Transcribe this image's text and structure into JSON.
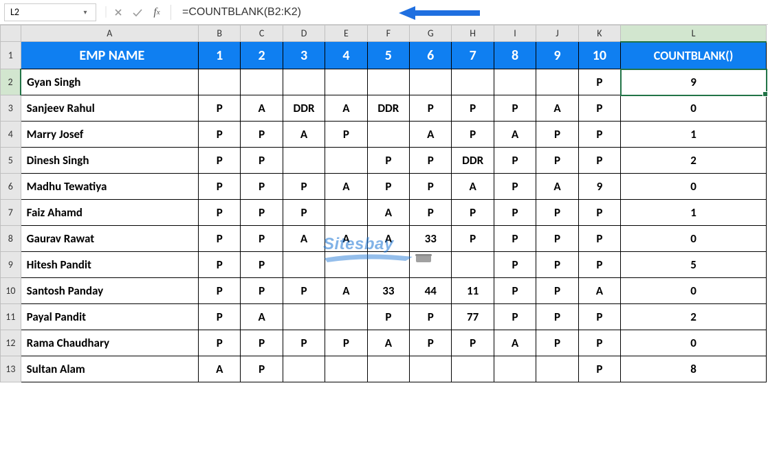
{
  "formula_bar": {
    "name_box": "L2",
    "formula": "=COUNTBLANK(B2:K2)"
  },
  "columns": [
    "A",
    "B",
    "C",
    "D",
    "E",
    "F",
    "G",
    "H",
    "I",
    "J",
    "K",
    "L"
  ],
  "row_numbers": [
    1,
    2,
    3,
    4,
    5,
    6,
    7,
    8,
    9,
    10,
    11,
    12,
    13
  ],
  "selected_cell": "L2",
  "header_row": {
    "name": "EMP NAME",
    "days": [
      "1",
      "2",
      "3",
      "4",
      "5",
      "6",
      "7",
      "8",
      "9",
      "10"
    ],
    "count_col": "COUNTBLANK()"
  },
  "rows": [
    {
      "name": "Gyan Singh",
      "d": [
        "",
        "",
        "",
        "",
        "",
        "",
        "",
        "",
        "",
        "P"
      ],
      "count": "9"
    },
    {
      "name": "Sanjeev Rahul",
      "d": [
        "P",
        "A",
        "DDR",
        "A",
        "DDR",
        "P",
        "P",
        "P",
        "A",
        "P"
      ],
      "count": "0"
    },
    {
      "name": "Marry Josef",
      "d": [
        "P",
        "P",
        "A",
        "P",
        "",
        "A",
        "P",
        "A",
        "P",
        "P"
      ],
      "count": "1"
    },
    {
      "name": "Dinesh Singh",
      "d": [
        "P",
        "P",
        "",
        "",
        "P",
        "P",
        "DDR",
        "P",
        "P",
        "P"
      ],
      "count": "2"
    },
    {
      "name": "Madhu Tewatiya",
      "d": [
        "P",
        "P",
        "P",
        "A",
        "P",
        "P",
        "A",
        "P",
        "A",
        "9"
      ],
      "count": "0"
    },
    {
      "name": "Faiz Ahamd",
      "d": [
        "P",
        "P",
        "P",
        "",
        "A",
        "P",
        "P",
        "P",
        "P",
        "P"
      ],
      "count": "1"
    },
    {
      "name": "Gaurav Rawat",
      "d": [
        "P",
        "P",
        "A",
        "A",
        "A",
        "33",
        "P",
        "P",
        "P",
        "P"
      ],
      "count": "0"
    },
    {
      "name": "Hitesh Pandit",
      "d": [
        "P",
        "P",
        "",
        "",
        "",
        "",
        "",
        "P",
        "P",
        "P"
      ],
      "count": "5"
    },
    {
      "name": "Santosh Panday",
      "d": [
        "P",
        "P",
        "P",
        "A",
        "33",
        "44",
        "11",
        "P",
        "P",
        "A"
      ],
      "count": "0"
    },
    {
      "name": "Payal Pandit",
      "d": [
        "P",
        "A",
        "",
        "",
        "P",
        "P",
        "77",
        "P",
        "P",
        "P"
      ],
      "count": "2"
    },
    {
      "name": "Rama Chaudhary",
      "d": [
        "P",
        "P",
        "P",
        "P",
        "A",
        "P",
        "P",
        "A",
        "P",
        "P"
      ],
      "count": "0"
    },
    {
      "name": "Sultan Alam",
      "d": [
        "A",
        "P",
        "",
        "",
        "",
        "",
        "",
        "",
        "",
        "P"
      ],
      "count": "8"
    }
  ],
  "watermark": {
    "text": "Sitesbay"
  },
  "chart_data": {
    "type": "table",
    "title": "COUNTBLANK example – employee attendance",
    "columns": [
      "EMP NAME",
      "1",
      "2",
      "3",
      "4",
      "5",
      "6",
      "7",
      "8",
      "9",
      "10",
      "COUNTBLANK()"
    ],
    "rows": [
      [
        "Gyan Singh",
        "",
        "",
        "",
        "",
        "",
        "",
        "",
        "",
        "",
        "P",
        9
      ],
      [
        "Sanjeev Rahul",
        "P",
        "A",
        "DDR",
        "A",
        "DDR",
        "P",
        "P",
        "P",
        "A",
        "P",
        0
      ],
      [
        "Marry Josef",
        "P",
        "P",
        "A",
        "P",
        "",
        "A",
        "P",
        "A",
        "P",
        "P",
        1
      ],
      [
        "Dinesh Singh",
        "P",
        "P",
        "",
        "",
        "P",
        "P",
        "DDR",
        "P",
        "P",
        "P",
        2
      ],
      [
        "Madhu Tewatiya",
        "P",
        "P",
        "P",
        "A",
        "P",
        "P",
        "A",
        "P",
        "A",
        "9",
        0
      ],
      [
        "Faiz Ahamd",
        "P",
        "P",
        "P",
        "",
        "A",
        "P",
        "P",
        "P",
        "P",
        "P",
        1
      ],
      [
        "Gaurav Rawat",
        "P",
        "P",
        "A",
        "A",
        "A",
        "33",
        "P",
        "P",
        "P",
        "P",
        0
      ],
      [
        "Hitesh Pandit",
        "P",
        "P",
        "",
        "",
        "",
        "",
        "",
        "P",
        "P",
        "P",
        5
      ],
      [
        "Santosh Panday",
        "P",
        "P",
        "P",
        "A",
        "33",
        "44",
        "11",
        "P",
        "P",
        "A",
        0
      ],
      [
        "Payal Pandit",
        "P",
        "A",
        "",
        "",
        "P",
        "P",
        "77",
        "P",
        "P",
        "P",
        2
      ],
      [
        "Rama Chaudhary",
        "P",
        "P",
        "P",
        "P",
        "A",
        "P",
        "P",
        "A",
        "P",
        "P",
        0
      ],
      [
        "Sultan Alam",
        "A",
        "P",
        "",
        "",
        "",
        "",
        "",
        "",
        "",
        "P",
        8
      ]
    ]
  }
}
